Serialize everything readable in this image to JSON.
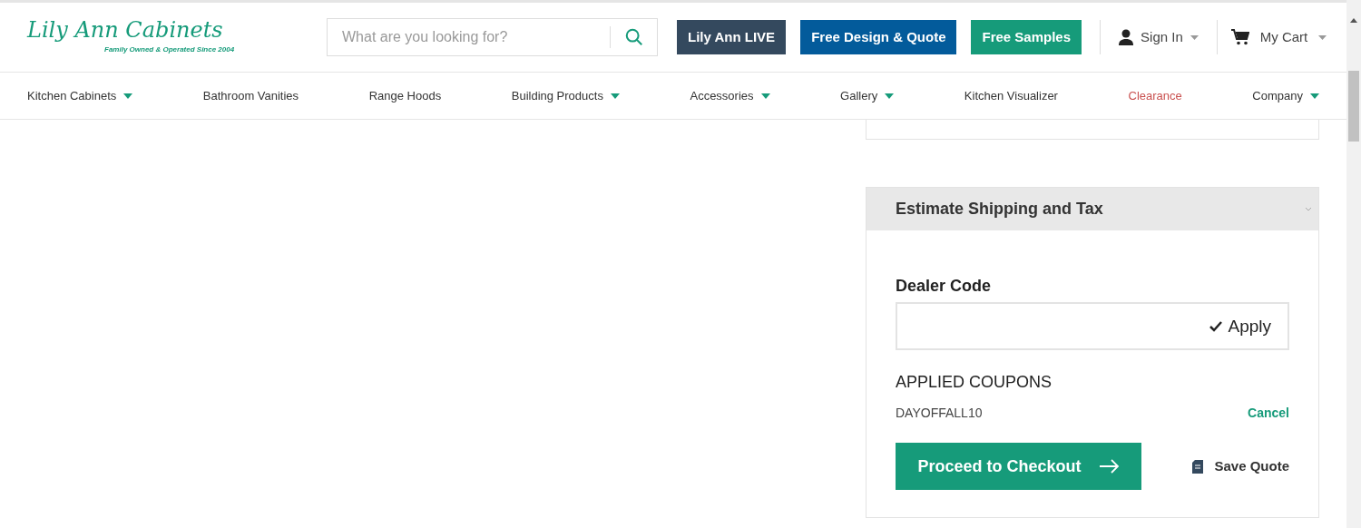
{
  "logo": {
    "name": "Lily Ann Cabinets",
    "tagline": "Family Owned & Operated Since 2004"
  },
  "search": {
    "placeholder": "What are you looking for?"
  },
  "header_buttons": [
    {
      "label": "Lily Ann LIVE",
      "color": "#34495e"
    },
    {
      "label": "Free Design & Quote",
      "color": "#035b9b"
    },
    {
      "label": "Free Samples",
      "color": "#169b7a"
    }
  ],
  "account": {
    "label": "Sign In"
  },
  "cart": {
    "label": "My Cart"
  },
  "nav": [
    {
      "label": "Kitchen Cabinets",
      "dropdown": true,
      "sale": false
    },
    {
      "label": "Bathroom Vanities",
      "dropdown": false,
      "sale": false
    },
    {
      "label": "Range Hoods",
      "dropdown": false,
      "sale": false
    },
    {
      "label": "Building Products",
      "dropdown": true,
      "sale": false
    },
    {
      "label": "Accessories",
      "dropdown": true,
      "sale": false
    },
    {
      "label": "Gallery",
      "dropdown": true,
      "sale": false
    },
    {
      "label": "Kitchen Visualizer",
      "dropdown": false,
      "sale": false
    },
    {
      "label": "Clearance",
      "dropdown": false,
      "sale": true
    },
    {
      "label": "Company",
      "dropdown": true,
      "sale": false
    }
  ],
  "estimate": {
    "title": "Estimate Shipping and Tax",
    "expanded": false
  },
  "dealer_code": {
    "label": "Dealer Code",
    "apply": "Apply"
  },
  "coupons": {
    "title": "APPLIED COUPONS",
    "items": [
      {
        "code": "DAYOFFALL10",
        "action": "Cancel"
      }
    ]
  },
  "checkout": {
    "label": "Proceed to Checkout"
  },
  "save_quote": {
    "label": "Save Quote"
  }
}
